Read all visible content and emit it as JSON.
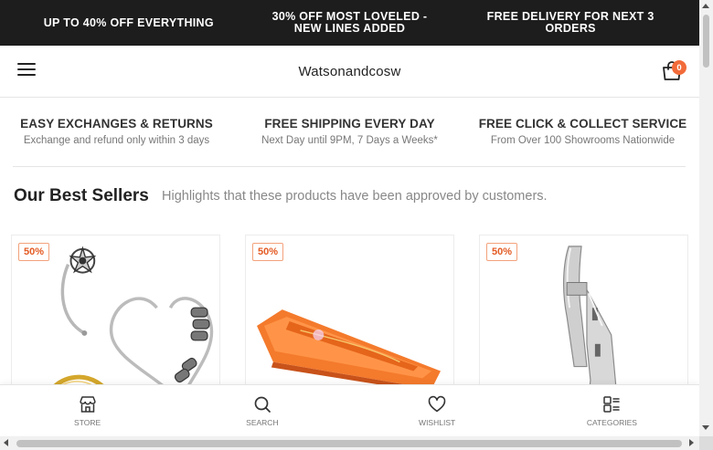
{
  "promo": {
    "items": [
      "UP TO 40% OFF EVERYTHING",
      "30% OFF MOST LOVELED - NEW LINES ADDED",
      "FREE DELIVERY FOR NEXT 3 ORDERS"
    ]
  },
  "header": {
    "logo": "Watsonandcosw",
    "cart_count": "0",
    "menu_icon": "hamburger-icon",
    "cart_icon": "shopping-bag-icon"
  },
  "services": [
    {
      "title": "EASY EXCHANGES & RETURNS",
      "subtitle": "Exchange and refund only within 3 days"
    },
    {
      "title": "FREE SHIPPING EVERY DAY",
      "subtitle": "Next Day until 9PM, 7 Days a Weeks*"
    },
    {
      "title": "FREE CLICK & COLLECT SERVICE",
      "subtitle": "From Over 100 Showrooms Nationwide"
    }
  ],
  "section": {
    "title": "Our Best Sellers",
    "subtitle": "Highlights that these products have been approved by customers."
  },
  "products": [
    {
      "badge": "50%",
      "image": "body-jewelry-rings-image"
    },
    {
      "badge": "50%",
      "image": "orange-snow-sled-image"
    },
    {
      "badge": "50%",
      "image": "window-latch-handle-image"
    }
  ],
  "bottom_nav": [
    {
      "label": "STORE",
      "icon": "store-icon"
    },
    {
      "label": "SEARCH",
      "icon": "search-icon"
    },
    {
      "label": "WISHLIST",
      "icon": "heart-icon"
    },
    {
      "label": "CATEGORIES",
      "icon": "categories-icon"
    }
  ],
  "colors": {
    "promo_bg": "#1d1d1d",
    "accent": "#f26b3a",
    "badge_text": "#e35a23"
  }
}
